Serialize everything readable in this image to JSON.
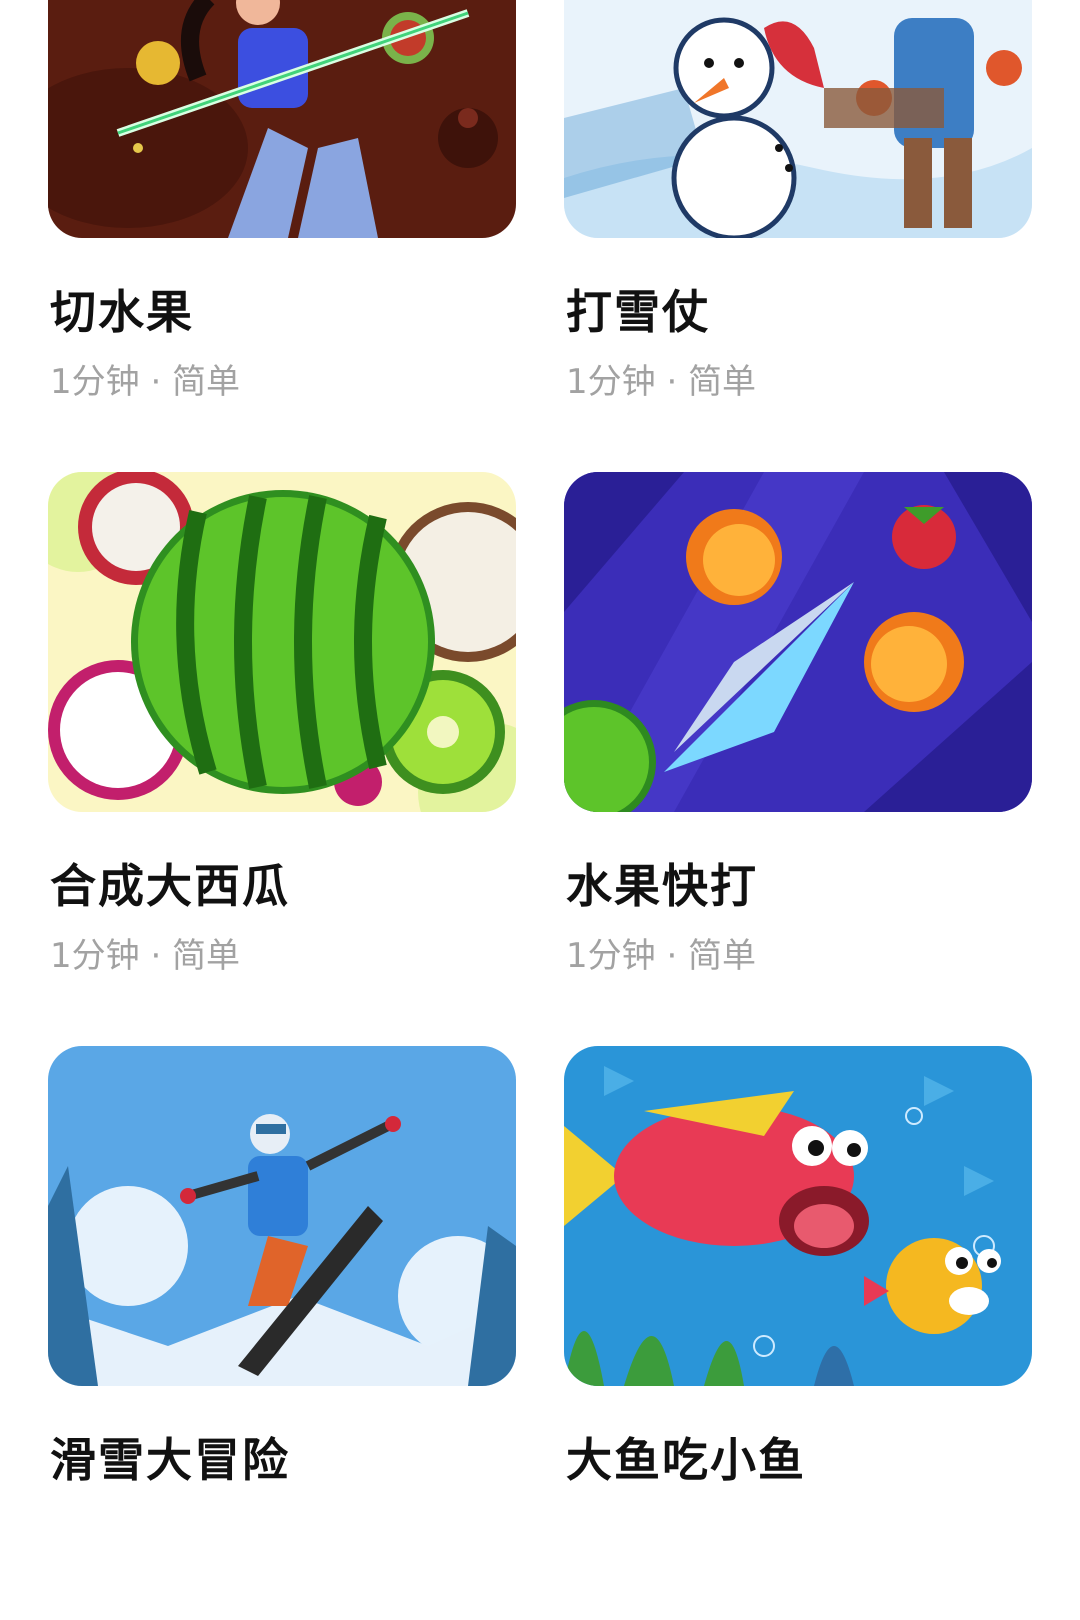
{
  "games": [
    {
      "title": "切水果",
      "meta": "1分钟 · 简单",
      "art": "fruit-ninja-artwork"
    },
    {
      "title": "打雪仗",
      "meta": "1分钟 · 简单",
      "art": "snowball-fight-artwork"
    },
    {
      "title": "合成大西瓜",
      "meta": "1分钟 · 简单",
      "art": "watermelon-merge-artwork"
    },
    {
      "title": "水果快打",
      "meta": "1分钟 · 简单",
      "art": "fruit-strike-artwork"
    },
    {
      "title": "滑雪大冒险",
      "meta": "",
      "art": "ski-adventure-artwork"
    },
    {
      "title": "大鱼吃小鱼",
      "meta": "",
      "art": "big-fish-artwork"
    }
  ]
}
